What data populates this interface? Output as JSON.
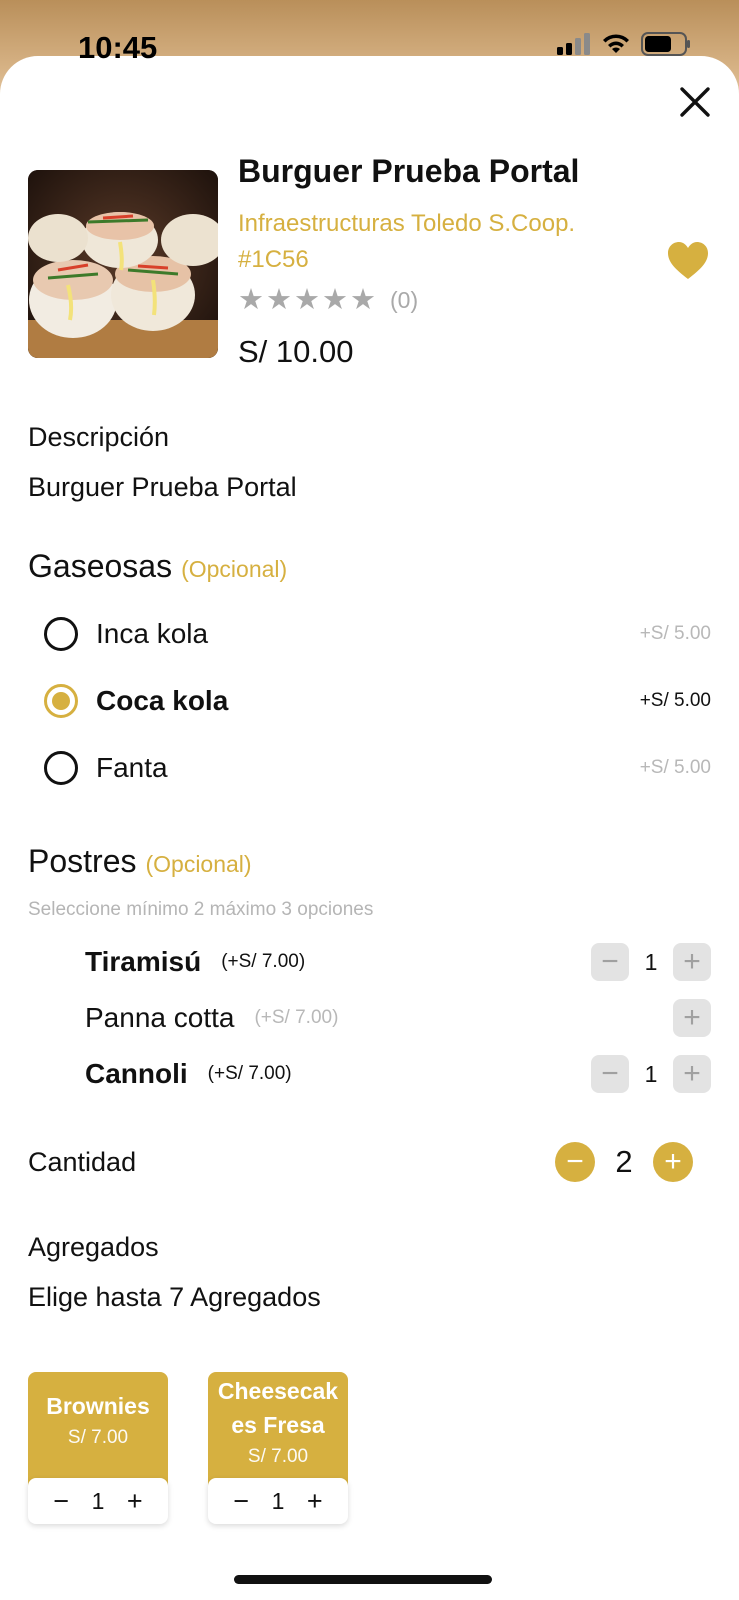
{
  "status_bar": {
    "time": "10:45"
  },
  "product": {
    "title": "Burguer Prueba Portal",
    "store": "Infraestructuras Toledo S.Coop. #1C56",
    "rating_count": "(0)",
    "rating_value": 0,
    "price": "S/ 10.00"
  },
  "description": {
    "label": "Descripción",
    "text": "Burguer Prueba Portal"
  },
  "gaseosas": {
    "title": "Gaseosas",
    "optional": "(Opcional)",
    "options": [
      {
        "label": "Inca kola",
        "price": "+S/ 5.00",
        "selected": false
      },
      {
        "label": "Coca kola",
        "price": "+S/ 5.00",
        "selected": true
      },
      {
        "label": "Fanta",
        "price": "+S/ 5.00",
        "selected": false
      }
    ]
  },
  "postres": {
    "title": "Postres",
    "optional": "(Opcional)",
    "hint": "Seleccione mínimo 2 máximo 3 opciones",
    "items": [
      {
        "name": "Tiramisú",
        "price": "(+S/ 7.00)",
        "qty": "1",
        "active": true
      },
      {
        "name": "Panna cotta",
        "price": "(+S/ 7.00)",
        "qty": "",
        "active": false
      },
      {
        "name": "Cannoli",
        "price": "(+S/ 7.00)",
        "qty": "1",
        "active": true
      }
    ]
  },
  "cantidad": {
    "label": "Cantidad",
    "value": "2"
  },
  "agregados": {
    "label": "Agregados",
    "subtitle": "Elige hasta 7 Agregados",
    "items": [
      {
        "name": "Brownies",
        "price": "S/ 7.00",
        "qty": "1"
      },
      {
        "name": "Cheesecakes Fresa",
        "name_line1": "Cheesecak",
        "name_line2": "es Fresa",
        "price": "S/ 7.00",
        "qty": "1"
      }
    ]
  },
  "colors": {
    "accent": "#d6b040",
    "text": "#111111",
    "muted": "#b5b5b5"
  },
  "icons": [
    "signal-icon",
    "wifi-icon",
    "battery-icon",
    "close-icon",
    "heart-icon",
    "star-icon",
    "minus-icon",
    "plus-icon"
  ]
}
